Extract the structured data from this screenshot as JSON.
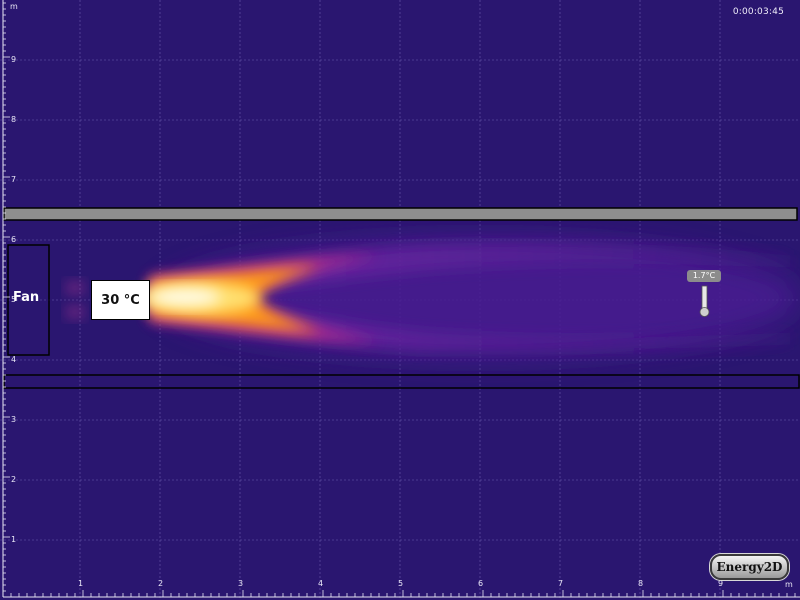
{
  "axis": {
    "unit": "m",
    "x_ticks": [
      "1",
      "2",
      "3",
      "4",
      "5",
      "6",
      "7",
      "8",
      "9"
    ],
    "y_ticks": [
      "1",
      "2",
      "3",
      "4",
      "5",
      "6",
      "7",
      "8",
      "9"
    ]
  },
  "timer": "0:00:03:45",
  "heater": {
    "label": "30 °C"
  },
  "fan": {
    "label": "Fan"
  },
  "thermometer": {
    "reading": "1.7°C"
  },
  "brand": "Energy2D",
  "colors": {
    "background": "#2a1670",
    "wall": "#8e8e8e",
    "plume_core": "#fffbe6",
    "plume_mid": "#ffb020",
    "plume_outer": "#b0208c"
  }
}
